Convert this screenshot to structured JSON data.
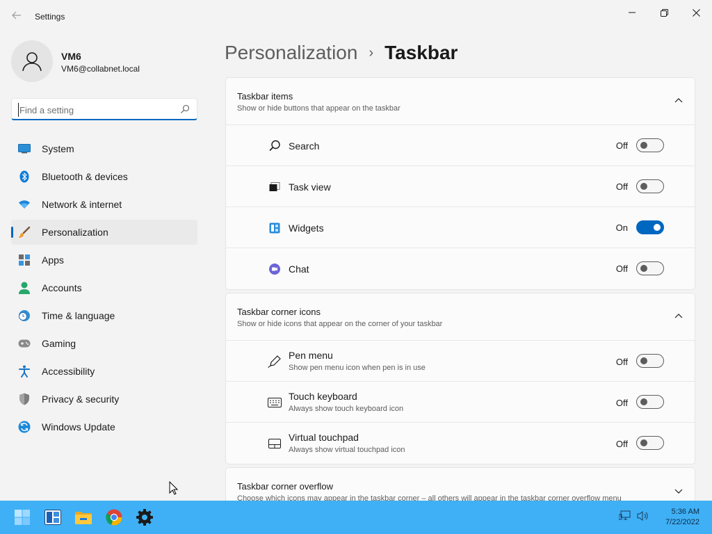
{
  "window": {
    "title": "Settings"
  },
  "profile": {
    "name": "VM6",
    "email": "VM6@collabnet.local"
  },
  "search": {
    "placeholder": "Find a setting"
  },
  "sidebar": {
    "items": [
      {
        "label": "System",
        "icon": "monitor-icon",
        "selected": false
      },
      {
        "label": "Bluetooth & devices",
        "icon": "bluetooth-icon",
        "selected": false
      },
      {
        "label": "Network & internet",
        "icon": "wifi-icon",
        "selected": false
      },
      {
        "label": "Personalization",
        "icon": "brush-icon",
        "selected": true
      },
      {
        "label": "Apps",
        "icon": "apps-icon",
        "selected": false
      },
      {
        "label": "Accounts",
        "icon": "person-icon",
        "selected": false
      },
      {
        "label": "Time & language",
        "icon": "clock-globe-icon",
        "selected": false
      },
      {
        "label": "Gaming",
        "icon": "gamepad-icon",
        "selected": false
      },
      {
        "label": "Accessibility",
        "icon": "accessibility-icon",
        "selected": false
      },
      {
        "label": "Privacy & security",
        "icon": "shield-icon",
        "selected": false
      },
      {
        "label": "Windows Update",
        "icon": "update-icon",
        "selected": false
      }
    ]
  },
  "breadcrumb": {
    "parent": "Personalization",
    "separator": "›",
    "current": "Taskbar"
  },
  "sections": {
    "items": {
      "title": "Taskbar items",
      "subtitle": "Show or hide buttons that appear on the taskbar",
      "expanded": true,
      "rows": [
        {
          "label": "Search",
          "state": "Off",
          "on": false,
          "icon": "search-icon"
        },
        {
          "label": "Task view",
          "state": "Off",
          "on": false,
          "icon": "task-view-icon"
        },
        {
          "label": "Widgets",
          "state": "On",
          "on": true,
          "icon": "widgets-icon"
        },
        {
          "label": "Chat",
          "state": "Off",
          "on": false,
          "icon": "chat-icon"
        }
      ]
    },
    "corner": {
      "title": "Taskbar corner icons",
      "subtitle": "Show or hide icons that appear on the corner of your taskbar",
      "expanded": true,
      "rows": [
        {
          "label": "Pen menu",
          "sub": "Show pen menu icon when pen is in use",
          "state": "Off",
          "on": false,
          "icon": "pen-icon"
        },
        {
          "label": "Touch keyboard",
          "sub": "Always show touch keyboard icon",
          "state": "Off",
          "on": false,
          "icon": "keyboard-icon"
        },
        {
          "label": "Virtual touchpad",
          "sub": "Always show virtual touchpad icon",
          "state": "Off",
          "on": false,
          "icon": "touchpad-icon"
        }
      ]
    },
    "overflow": {
      "title": "Taskbar corner overflow",
      "subtitle": "Choose which icons may appear in the taskbar corner – all others will appear in the taskbar corner overflow menu",
      "expanded": false
    }
  },
  "taskbar": {
    "apps": [
      "start-icon",
      "widgets-app-icon",
      "file-explorer-icon",
      "chrome-icon",
      "settings-app-icon"
    ],
    "time": "5:36 AM",
    "date": "7/22/2022"
  },
  "colors": {
    "accent": "#0067c0",
    "taskbar": "#3fb0f5",
    "background": "#f3f3f3"
  }
}
